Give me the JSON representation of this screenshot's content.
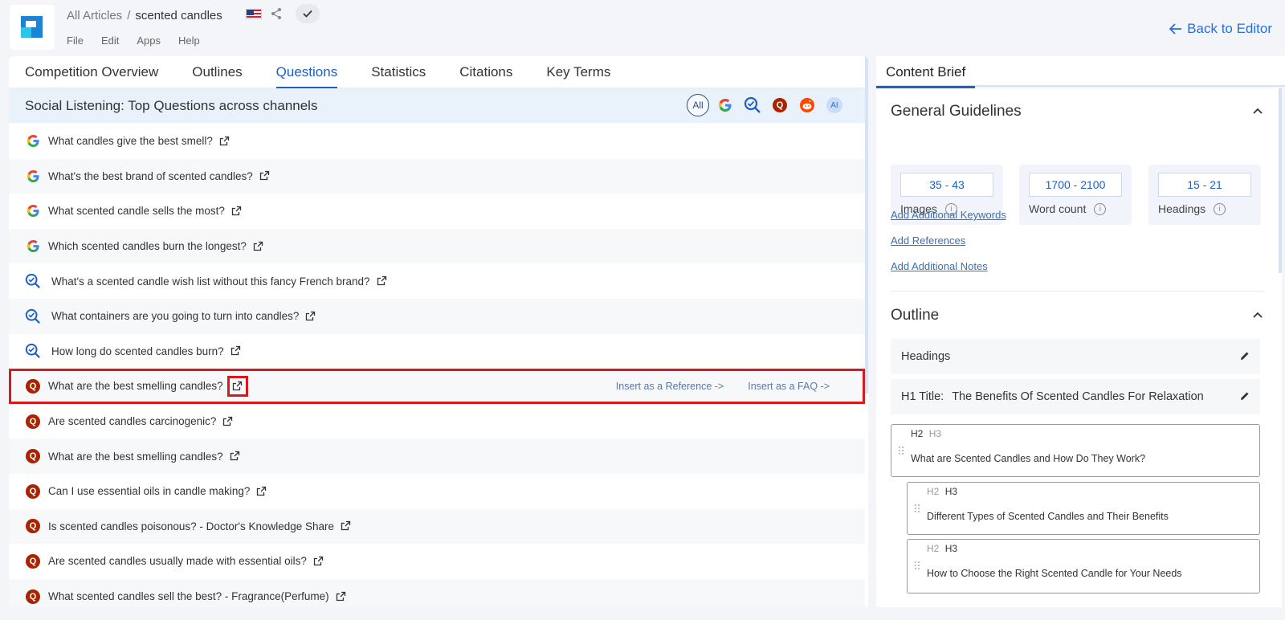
{
  "breadcrumb": {
    "root": "All Articles",
    "separator": "/",
    "current": "scented candles"
  },
  "menu": [
    "File",
    "Edit",
    "Apps",
    "Help"
  ],
  "back_label": "Back to Editor",
  "tabs": [
    "Competition Overview",
    "Outlines",
    "Questions",
    "Statistics",
    "Citations",
    "Key Terms"
  ],
  "active_tab": "Questions",
  "social": {
    "title": "Social Listening: Top Questions across channels",
    "filter_all": "All",
    "filter_ai": "AI"
  },
  "questions": [
    {
      "source": "google",
      "text": "What candles give the best smell?"
    },
    {
      "source": "google",
      "text": "What's the best brand of scented candles?"
    },
    {
      "source": "google",
      "text": "What scented candle sells the most?"
    },
    {
      "source": "google",
      "text": "Which scented candles burn the longest?"
    },
    {
      "source": "search",
      "text": "What's a scented candle wish list without this fancy French brand?"
    },
    {
      "source": "search",
      "text": "What containers are you going to turn into candles?"
    },
    {
      "source": "search",
      "text": "How long do scented candles burn?"
    },
    {
      "source": "quora",
      "text": "What are the best smelling candles?"
    },
    {
      "source": "quora",
      "text": "Are scented candles carcinogenic?"
    },
    {
      "source": "quora",
      "text": "What are the best smelling candles?"
    },
    {
      "source": "quora",
      "text": "Can I use essential oils in candle making?"
    },
    {
      "source": "quora",
      "text": "Is scented candles poisonous? - Doctor's Knowledge Share"
    },
    {
      "source": "quora",
      "text": "Are scented candles usually made with essential oils?"
    },
    {
      "source": "quora",
      "text": "What scented candles sell the best? - Fragrance(Perfume)"
    }
  ],
  "row_actions": {
    "reference": "Insert as a Reference ->",
    "faq": "Insert as a FAQ ->"
  },
  "brief": {
    "tab": "Content Brief",
    "guidelines_title": "General Guidelines",
    "stats": [
      {
        "value": "35 - 43",
        "label": "Images"
      },
      {
        "value": "1700 - 2100",
        "label": "Word count"
      },
      {
        "value": "15 - 21",
        "label": "Headings"
      }
    ],
    "info_glyph": "i",
    "links": [
      "Add Additional Keywords",
      "Add References",
      "Add Additional Notes"
    ],
    "outline_title": "Outline",
    "headings_label": "Headings",
    "h1_label": "H1 Title:",
    "h1_value": "The Benefits Of Scented Candles For Relaxation",
    "cards": [
      {
        "h2": "H2",
        "h3": "H3",
        "active": "H2",
        "text": "What are Scented Candles and How Do They Work?"
      },
      {
        "h2": "H2",
        "h3": "H3",
        "active": "H3",
        "text": "Different Types of Scented Candles and Their Benefits"
      },
      {
        "h2": "H2",
        "h3": "H3",
        "active": "H3",
        "text": "How to Choose the Right Scented Candle for Your Needs"
      }
    ]
  },
  "colors": {
    "accent": "#1f5fbf",
    "highlight": "#d71920",
    "quora": "#a82400"
  }
}
